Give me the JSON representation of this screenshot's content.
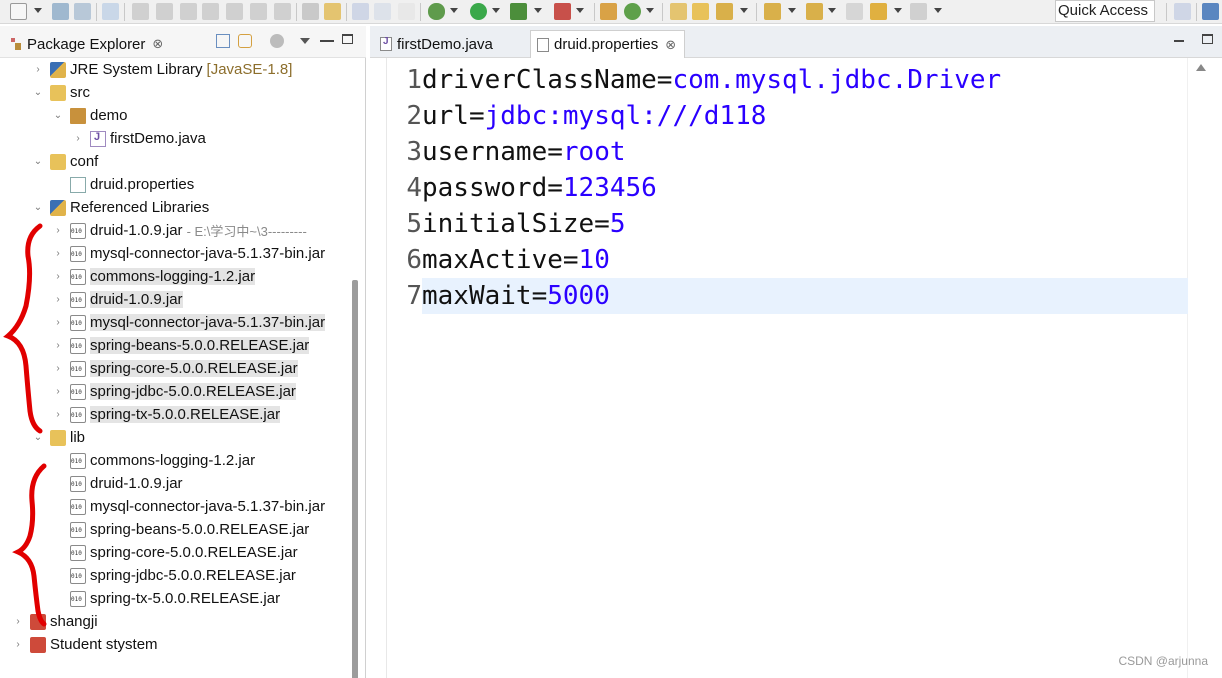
{
  "toolbar": {
    "quick_access": "Quick Access"
  },
  "left_pane": {
    "title": "Package Explorer",
    "close": "⊗"
  },
  "tree": [
    {
      "label": "JRE System Library",
      "sub": "[JavaSE-1.8]",
      "indent": 1,
      "twisty": "›",
      "icon": "lib"
    },
    {
      "label": "src",
      "indent": 1,
      "twisty": "⌄",
      "icon": "folder"
    },
    {
      "label": "demo",
      "indent": 2,
      "twisty": "⌄",
      "icon": "package"
    },
    {
      "label": "firstDemo.java",
      "indent": 3,
      "twisty": "›",
      "icon": "java"
    },
    {
      "label": "conf",
      "indent": 1,
      "twisty": "⌄",
      "icon": "folder"
    },
    {
      "label": "druid.properties",
      "indent": 2,
      "twisty": "",
      "icon": "file"
    },
    {
      "label": "Referenced Libraries",
      "indent": 1,
      "twisty": "⌄",
      "icon": "lib"
    },
    {
      "label": "druid-1.0.9.jar",
      "sub_gray": "- E:\\学习中~\\3---------",
      "indent": 2,
      "twisty": "›",
      "icon": "jar"
    },
    {
      "label": "mysql-connector-java-5.1.37-bin.jar",
      "indent": 2,
      "twisty": "›",
      "icon": "jar"
    },
    {
      "label": "commons-logging-1.2.jar",
      "indent": 2,
      "twisty": "›",
      "icon": "jar",
      "highlight": true
    },
    {
      "label": "druid-1.0.9.jar",
      "indent": 2,
      "twisty": "›",
      "icon": "jar",
      "highlight": true
    },
    {
      "label": "mysql-connector-java-5.1.37-bin.jar",
      "indent": 2,
      "twisty": "›",
      "icon": "jar",
      "highlight": true
    },
    {
      "label": "spring-beans-5.0.0.RELEASE.jar",
      "indent": 2,
      "twisty": "›",
      "icon": "jar",
      "highlight": true
    },
    {
      "label": "spring-core-5.0.0.RELEASE.jar",
      "indent": 2,
      "twisty": "›",
      "icon": "jar",
      "highlight": true
    },
    {
      "label": "spring-jdbc-5.0.0.RELEASE.jar",
      "indent": 2,
      "twisty": "›",
      "icon": "jar",
      "highlight": true
    },
    {
      "label": "spring-tx-5.0.0.RELEASE.jar",
      "indent": 2,
      "twisty": "›",
      "icon": "jar",
      "highlight": true
    },
    {
      "label": "lib",
      "indent": 1,
      "twisty": "⌄",
      "icon": "folder"
    },
    {
      "label": "commons-logging-1.2.jar",
      "indent": 2,
      "twisty": "",
      "icon": "jar"
    },
    {
      "label": "druid-1.0.9.jar",
      "indent": 2,
      "twisty": "",
      "icon": "jar"
    },
    {
      "label": "mysql-connector-java-5.1.37-bin.jar",
      "indent": 2,
      "twisty": "",
      "icon": "jar"
    },
    {
      "label": "spring-beans-5.0.0.RELEASE.jar",
      "indent": 2,
      "twisty": "",
      "icon": "jar"
    },
    {
      "label": "spring-core-5.0.0.RELEASE.jar",
      "indent": 2,
      "twisty": "",
      "icon": "jar"
    },
    {
      "label": "spring-jdbc-5.0.0.RELEASE.jar",
      "indent": 2,
      "twisty": "",
      "icon": "jar"
    },
    {
      "label": "spring-tx-5.0.0.RELEASE.jar",
      "indent": 2,
      "twisty": "",
      "icon": "jar"
    },
    {
      "label": "shangji",
      "indent": 0,
      "twisty": "›",
      "icon": "project"
    },
    {
      "label": "Student stystem",
      "indent": 0,
      "twisty": "›",
      "icon": "project"
    }
  ],
  "editor": {
    "tabs": [
      {
        "label": "firstDemo.java",
        "active": false
      },
      {
        "label": "druid.properties",
        "active": true,
        "close": "⊗"
      }
    ],
    "lines": [
      {
        "num": "1",
        "key": "driverClassName=",
        "value": "com.mysql.jdbc.Driver"
      },
      {
        "num": "2",
        "key": "url=",
        "value": "jdbc:mysql:///d118"
      },
      {
        "num": "3",
        "key": "username=",
        "value": "root"
      },
      {
        "num": "4",
        "key": "password=",
        "value": "123456"
      },
      {
        "num": "5",
        "key": "initialSize=",
        "value": "5"
      },
      {
        "num": "6",
        "key": "maxActive=",
        "value": "10"
      },
      {
        "num": "7",
        "key": "maxWait=",
        "value": "5000"
      }
    ],
    "current_line": 7
  },
  "watermark": "CSDN @arjunna",
  "colors": {
    "value_blue": "#2a00ff",
    "current_line_bg": "#e8f2fe",
    "annotation_red": "#e10000"
  }
}
